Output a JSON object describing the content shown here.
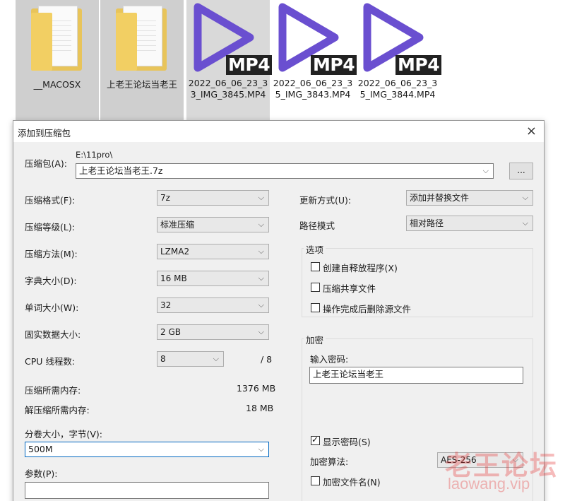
{
  "files": [
    {
      "name": "__MACOSX",
      "kind": "folder",
      "selected": true
    },
    {
      "name": "上老王论坛当老王",
      "kind": "folder",
      "selected": true
    },
    {
      "name": "2022_06_06_23_33_IMG_3845.MP4",
      "kind": "mp4",
      "selected": true
    },
    {
      "name": "2022_06_06_23_35_IMG_3843.MP4",
      "kind": "mp4",
      "selected": false
    },
    {
      "name": "2022_06_06_23_35_IMG_3844.MP4",
      "kind": "mp4",
      "selected": false
    }
  ],
  "mp4_badge": "MP4",
  "dialog": {
    "title": "添加到压缩包",
    "close_icon": "×",
    "archive_label": "压缩包(A):",
    "archive_path_hint": "E:\\11pro\\",
    "archive_value": "上老王论坛当老王.7z",
    "browse_label": "...",
    "format_label": "压缩格式(F):",
    "format_value": "7z",
    "level_label": "压缩等级(L):",
    "level_value": "标准压缩",
    "method_label": "压缩方法(M):",
    "method_value": "LZMA2",
    "dict_label": "字典大小(D):",
    "dict_value": "16 MB",
    "word_label": "单词大小(W):",
    "word_value": "32",
    "solid_label": "固实数据大小:",
    "solid_value": "2 GB",
    "threads_label": "CPU 线程数:",
    "threads_value": "8",
    "threads_max": "/ 8",
    "mem_comp_label": "压缩所需内存:",
    "mem_comp_value": "1376 MB",
    "mem_decomp_label": "解压缩所需内存:",
    "mem_decomp_value": "18 MB",
    "volume_label": "分卷大小，字节(V):",
    "volume_value": "500M",
    "params_label": "参数(P):",
    "params_value": "",
    "update_label": "更新方式(U):",
    "update_value": "添加并替换文件",
    "path_label": "路径模式",
    "path_value": "相对路径",
    "options_title": "选项",
    "opt_sfx": "创建自释放程序(X)",
    "opt_shared": "压缩共享文件",
    "opt_delete": "操作完成后删除源文件",
    "encrypt_title": "加密",
    "password_label": "输入密码:",
    "password_value": "上老王论坛当老王",
    "show_password": "显示密码(S)",
    "enc_method_label": "加密算法:",
    "enc_method_value": "AES-256",
    "encrypt_names": "加密文件名(N)"
  },
  "watermark": {
    "cn": "老王论坛",
    "url": "laowang.vip"
  }
}
